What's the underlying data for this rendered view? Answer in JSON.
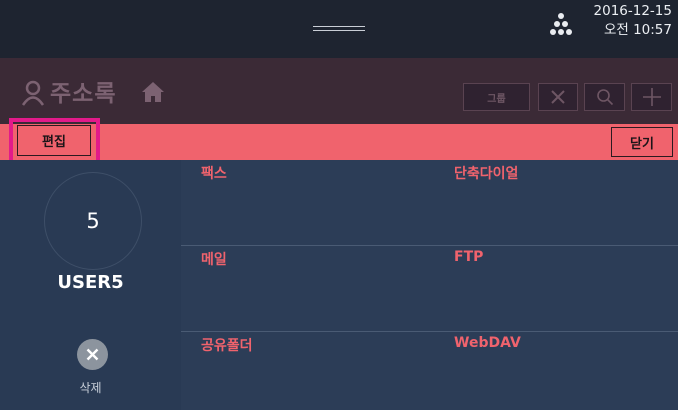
{
  "status": {
    "date": "2016-12-15",
    "time": "오전 10:57"
  },
  "header": {
    "title": "주소록",
    "group_label": "그룹"
  },
  "icons": {
    "person": "person-icon",
    "home": "home-icon",
    "close": "x-icon",
    "search": "search-icon",
    "add": "plus-icon",
    "network": "network-dots-icon",
    "delete": "x-circle-icon"
  },
  "toolbar": {
    "edit_label": "편집",
    "close_label": "닫기"
  },
  "user": {
    "number": "5",
    "name": "USER5",
    "delete_label": "삭제"
  },
  "destinations": [
    {
      "label": "팩스"
    },
    {
      "label": "단축다이얼"
    },
    {
      "label": "메일"
    },
    {
      "label": "FTP"
    },
    {
      "label": "공유폴더"
    },
    {
      "label": "WebDAV"
    }
  ],
  "colors": {
    "accent": "#f0636d",
    "highlight": "#e21a8a",
    "panel": "#2c3d57",
    "title_bar": "#3b2a36",
    "status_bar": "#1e2430"
  }
}
